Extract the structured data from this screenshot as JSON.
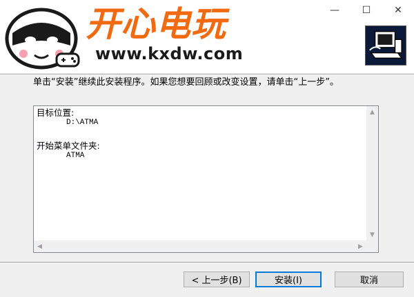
{
  "header": {
    "brand_title": "开心电玩",
    "brand_url": "www.kxdw.com"
  },
  "window_controls": {
    "minimize": "—",
    "maximize": "☐",
    "close": "✕"
  },
  "instruction": "单击“安装”继续此安装程序。如果您想要回顾或改变设置，请单击“上一步”。",
  "info": {
    "target_label": "目标位置:",
    "target_value": "D:\\ATMA",
    "menu_label": "开始菜单文件夹:",
    "menu_value": "ATMA"
  },
  "scroll": {
    "up": "▲",
    "down": "▼",
    "left": "◀",
    "right": "▶"
  },
  "buttons": {
    "back": "< 上一步(B)",
    "install": "安装(I)",
    "cancel": "取消"
  },
  "colors": {
    "brand_orange": "#f26a10",
    "default_button_border": "#0078d7"
  }
}
